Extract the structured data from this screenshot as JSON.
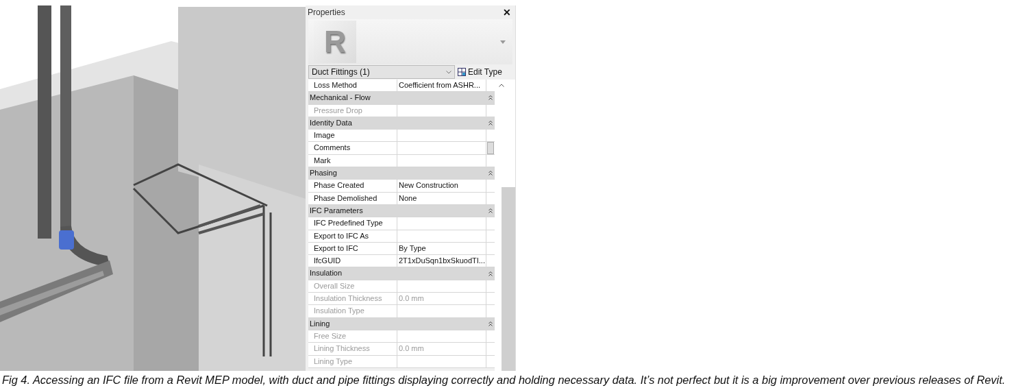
{
  "properties": {
    "title": "Properties",
    "close": "✕",
    "logo_letter": "R",
    "type_selector": {
      "value": "Duct Fittings (1)"
    },
    "edit_type": "Edit Type",
    "rows": [
      {
        "kind": "param",
        "name": "Loss Method",
        "value": "Coefficient from ASHR...",
        "disabled": false
      },
      {
        "kind": "group",
        "name": "Mechanical - Flow",
        "expanded": true
      },
      {
        "kind": "param",
        "name": "Pressure Drop",
        "value": "",
        "disabled": true
      },
      {
        "kind": "group",
        "name": "Identity Data",
        "expanded": true
      },
      {
        "kind": "param",
        "name": "Image",
        "value": "",
        "disabled": false
      },
      {
        "kind": "param",
        "name": "Comments",
        "value": "",
        "disabled": false
      },
      {
        "kind": "param",
        "name": "Mark",
        "value": "",
        "disabled": false
      },
      {
        "kind": "group",
        "name": "Phasing",
        "expanded": true
      },
      {
        "kind": "param",
        "name": "Phase Created",
        "value": "New Construction",
        "disabled": false
      },
      {
        "kind": "param",
        "name": "Phase Demolished",
        "value": "None",
        "disabled": false
      },
      {
        "kind": "group",
        "name": "IFC Parameters",
        "expanded": true
      },
      {
        "kind": "param",
        "name": "IFC Predefined Type",
        "value": "",
        "disabled": false
      },
      {
        "kind": "param",
        "name": "Export to IFC As",
        "value": "",
        "disabled": false
      },
      {
        "kind": "param",
        "name": "Export to IFC",
        "value": "By Type",
        "disabled": false
      },
      {
        "kind": "param",
        "name": "IfcGUID",
        "value": "2T1xDuSqn1bxSkuodTI...",
        "disabled": false
      },
      {
        "kind": "group",
        "name": "Insulation",
        "expanded": true
      },
      {
        "kind": "param",
        "name": "Overall Size",
        "value": "",
        "disabled": true
      },
      {
        "kind": "param",
        "name": "Insulation Thickness",
        "value": "0.0 mm",
        "disabled": true
      },
      {
        "kind": "param",
        "name": "Insulation Type",
        "value": "",
        "disabled": true
      },
      {
        "kind": "group",
        "name": "Lining",
        "expanded": true
      },
      {
        "kind": "param",
        "name": "Free Size",
        "value": "",
        "disabled": true
      },
      {
        "kind": "param",
        "name": "Lining Thickness",
        "value": "0.0 mm",
        "disabled": true
      },
      {
        "kind": "param",
        "name": "Lining Type",
        "value": "",
        "disabled": true
      }
    ]
  },
  "caption": "Fig 4. Accessing an IFC file from a Revit MEP model, with duct and pipe fittings displaying correctly and holding necessary data. It’s not perfect but it is a big improvement over previous releases of Revit."
}
